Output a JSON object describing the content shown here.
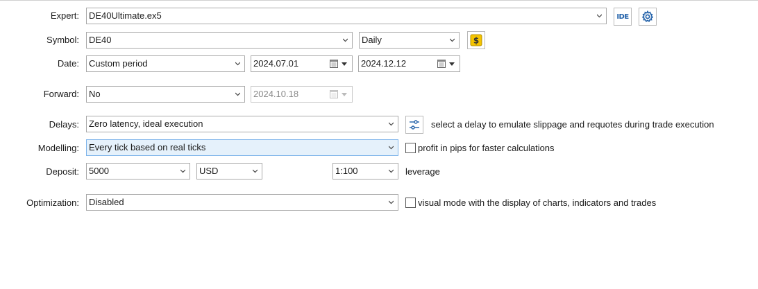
{
  "expert": {
    "label": "Expert:",
    "value": "DE40Ultimate.ex5",
    "ide_label": "IDE"
  },
  "symbol": {
    "label": "Symbol:",
    "value": "DE40",
    "period": "Daily"
  },
  "date": {
    "label": "Date:",
    "mode": "Custom period",
    "from": "2024.07.01",
    "to": "2024.12.12"
  },
  "forward": {
    "label": "Forward:",
    "value": "No",
    "date": "2024.10.18"
  },
  "delays": {
    "label": "Delays:",
    "value": "Zero latency, ideal execution",
    "hint": "select a delay to emulate slippage and requotes during trade execution"
  },
  "modelling": {
    "label": "Modelling:",
    "value": "Every tick based on real ticks",
    "option_label": "profit in pips for faster calculations"
  },
  "deposit": {
    "label": "Deposit:",
    "value": "5000",
    "currency": "USD",
    "leverage_value": "1:100",
    "leverage_label": "leverage"
  },
  "optimization": {
    "label": "Optimization:",
    "value": "Disabled",
    "option_label": "visual mode with the display of charts, indicators and trades"
  },
  "colors": {
    "highlight_bg": "#e5f1fb",
    "highlight_border": "#7eb4ea",
    "ide_text": "#1f5fa8",
    "gear": "#1f5fa8",
    "dollar_bg": "#f5c400"
  },
  "icons": {
    "settings": "gear-icon",
    "symbol_props": "dollar-icon",
    "delay_settings": "sliders-icon",
    "calendar": "calendar-icon"
  }
}
